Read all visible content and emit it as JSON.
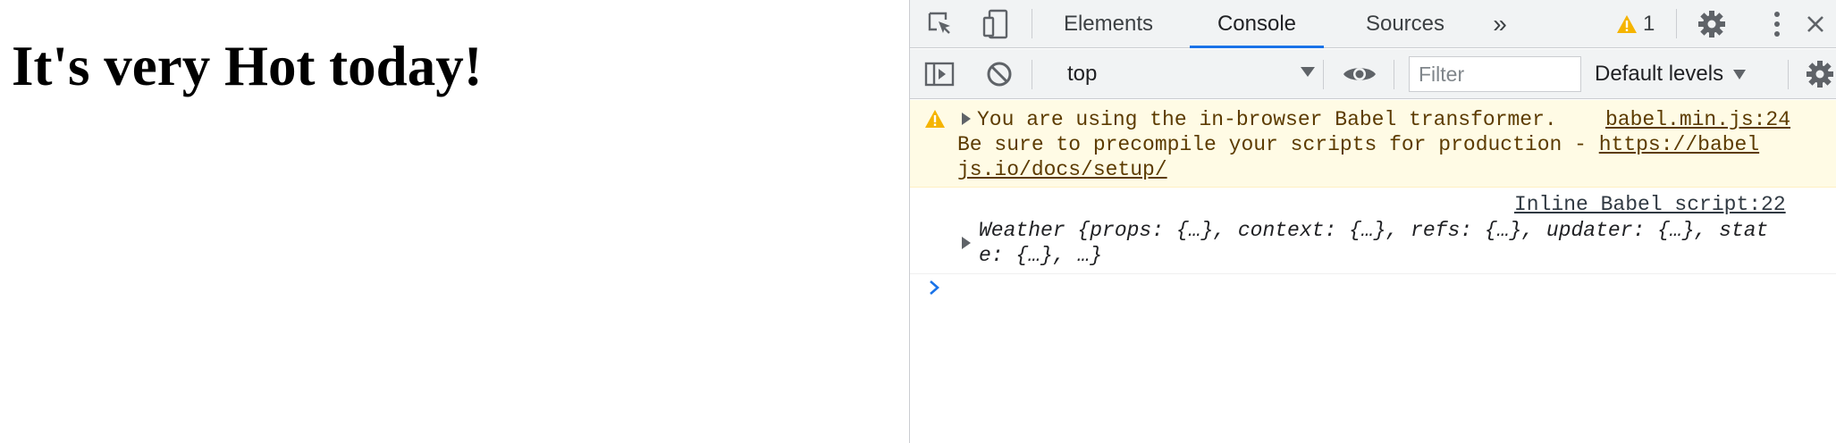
{
  "page": {
    "heading": "It's very Hot today!"
  },
  "devtools": {
    "tabs": [
      "Elements",
      "Console",
      "Sources"
    ],
    "active_tab": "Console",
    "more_tabs_label": "»",
    "warning_count": "1",
    "toolbar": {
      "context": "top",
      "filter_placeholder": "Filter",
      "levels_label": "Default levels"
    },
    "console": {
      "warning": {
        "line1": "You are using the in-browser Babel transformer.",
        "source": "babel.min.js:24",
        "line2_prefix": "Be sure to precompile your scripts for production - ",
        "url_part1": "https://babel",
        "url_part2": "js.io/docs/setup/"
      },
      "log": {
        "source": "Inline Babel script:22",
        "line1": "Weather {props: {…}, context: {…}, refs: {…}, updater: {…}, stat",
        "line2": "e: {…}, …}"
      }
    },
    "colors": {
      "accent": "#1a73e8",
      "warning_bg": "#fffbe5",
      "warning_icon": "#f5b400"
    }
  }
}
